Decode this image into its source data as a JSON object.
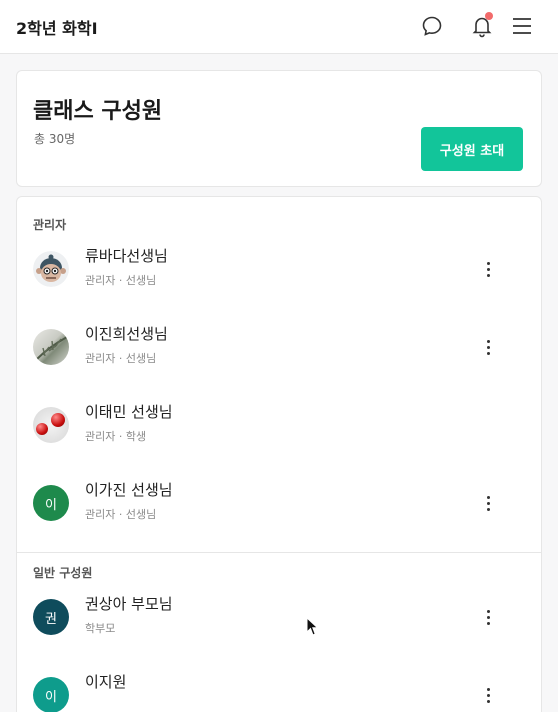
{
  "app": {
    "title": "2학년 화학I"
  },
  "colors": {
    "accent": "#12c59a",
    "notification_dot": "#f26b6b"
  },
  "icons": {
    "chat": "chat-bubble-icon",
    "bell": "bell-icon",
    "menu": "hamburger-menu-icon",
    "more": "more-vertical-icon"
  },
  "header": {
    "title": "클래스 구성원",
    "count": "총 30명",
    "invite_label": "구성원 초대"
  },
  "sections": {
    "admin_label": "관리자",
    "general_label": "일반 구성원"
  },
  "admins": [
    {
      "name": "류바다선생님",
      "role": "관리자 · 선생님",
      "avatar": "monkey-character"
    },
    {
      "name": "이진희선생님",
      "role": "관리자 · 선생님",
      "avatar": "plant-photo"
    },
    {
      "name": "이태민 선생님",
      "role": "관리자 · 학생",
      "avatar": "red-balls-photo"
    },
    {
      "name": "이가진 선생님",
      "role": "관리자 · 선생님",
      "avatar_initial": "이"
    }
  ],
  "general": [
    {
      "name": "권상아 부모님",
      "role": "학부모",
      "avatar_initial": "권"
    },
    {
      "name": "이지원",
      "role": "",
      "avatar_initial": "이"
    }
  ]
}
